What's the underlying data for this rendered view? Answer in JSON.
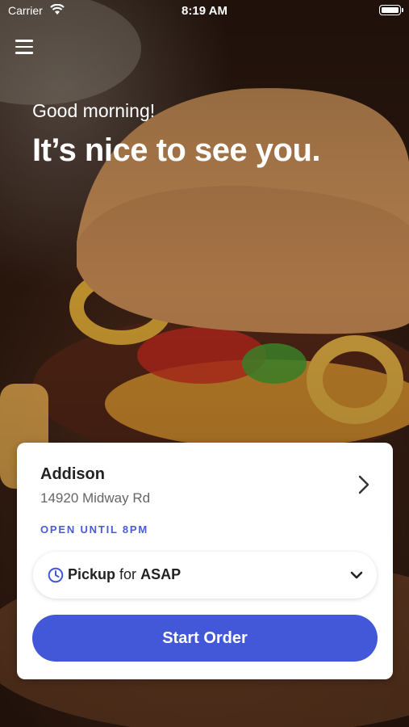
{
  "status_bar": {
    "carrier": "Carrier",
    "time": "8:19 AM"
  },
  "header": {
    "greeting": "Good morning!",
    "headline": "It’s nice to see you."
  },
  "store": {
    "name": "Addison",
    "address": "14920 Midway Rd",
    "hours": "OPEN UNTIL 8PM"
  },
  "order_mode": {
    "mode": "Pickup",
    "connector": "for",
    "time": "ASAP"
  },
  "actions": {
    "start_order": "Start Order"
  },
  "colors": {
    "accent": "#4358d9",
    "hours_text": "#4a5bd8"
  },
  "icons": {
    "menu": "hamburger-icon",
    "wifi": "wifi-icon",
    "battery": "battery-icon",
    "clock": "clock-icon",
    "store_chevron": "chevron-right-icon",
    "dropdown": "chevron-down-icon"
  }
}
